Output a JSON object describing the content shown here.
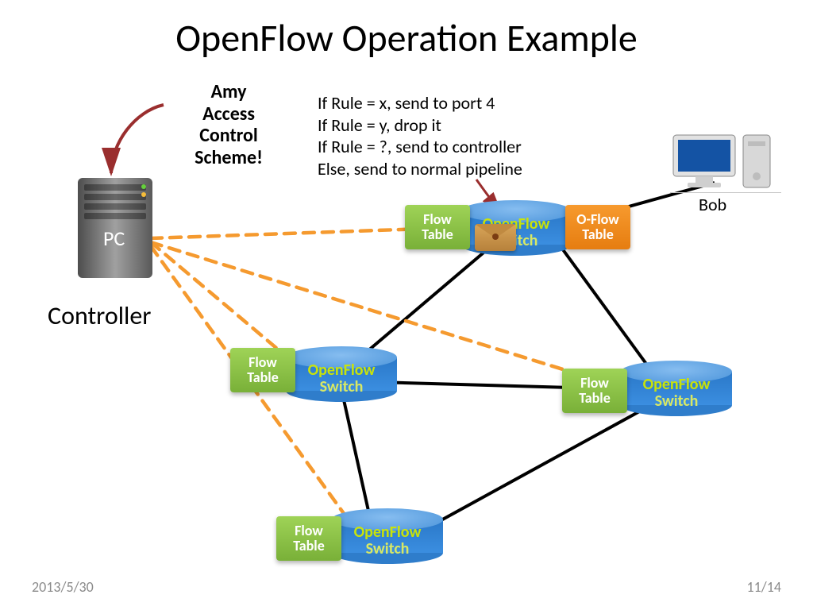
{
  "title": "OpenFlow Operation Example",
  "amy_lines": [
    "Amy",
    "Access",
    "Control",
    "Scheme!"
  ],
  "rules": [
    "If Rule = x, send to port 4",
    "If Rule = y, drop it",
    "If Rule = ?, send to controller",
    "Else, send to normal pipeline"
  ],
  "labels": {
    "pc": "PC",
    "controller": "Controller",
    "bob": "Bob"
  },
  "flow_table_label": "Flow\nTable",
  "oflow_table_label": "O-Flow\nTable",
  "switch_line1": "OpenFlow",
  "switch_line2": "Switch",
  "date": "2013/5/30",
  "page": "11/14",
  "graphic": {
    "nodes": {
      "controller": {
        "role": "SDN controller PC",
        "neighbors_dashed": [
          "sw_top",
          "sw_left",
          "sw_right",
          "sw_bottom"
        ]
      },
      "sw_top": {
        "role": "OpenFlow Switch",
        "flow_tables": [
          "Flow Table",
          "O-Flow Table"
        ],
        "extra": "envelope-packet"
      },
      "sw_left": {
        "role": "OpenFlow Switch",
        "flow_tables": [
          "Flow Table"
        ]
      },
      "sw_right": {
        "role": "OpenFlow Switch",
        "flow_tables": [
          "Flow Table"
        ]
      },
      "sw_bottom": {
        "role": "OpenFlow Switch",
        "flow_tables": [
          "Flow Table"
        ]
      },
      "bob_pc": {
        "role": "Host (Bob’s PC)"
      }
    },
    "solid_links": [
      [
        "sw_top",
        "sw_left"
      ],
      [
        "sw_top",
        "sw_right"
      ],
      [
        "sw_left",
        "sw_bottom"
      ],
      [
        "sw_left",
        "sw_right"
      ],
      [
        "sw_right",
        "sw_bottom"
      ],
      [
        "sw_top",
        "bob_pc"
      ]
    ],
    "callouts": {
      "amy_arrow": "Amy Access Control Scheme! → Controller",
      "rules_arrow": "rule list → sw_top"
    }
  }
}
